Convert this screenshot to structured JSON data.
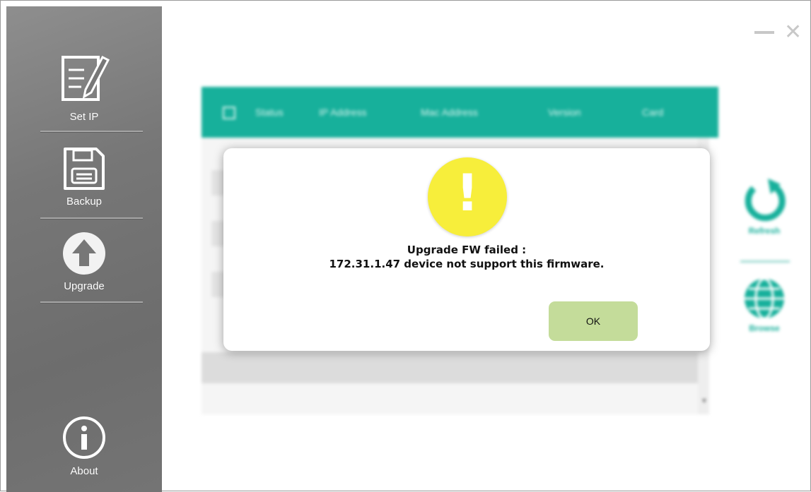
{
  "sidebar": {
    "items": [
      {
        "label": "Set IP",
        "icon": "edit-document-icon"
      },
      {
        "label": "Backup",
        "icon": "floppy-disk-icon"
      },
      {
        "label": "Upgrade",
        "icon": "upload-arrow-icon"
      }
    ],
    "about": {
      "label": "About",
      "icon": "info-icon"
    }
  },
  "window": {
    "minimize": "—",
    "close": "✕"
  },
  "table": {
    "headers": [
      "Status",
      "IP Address",
      "Mac Address",
      "Version",
      "Card"
    ]
  },
  "tools": {
    "refresh_label": "Refresh",
    "browse_label": "Browse"
  },
  "dialog": {
    "icon": "warning-icon",
    "icon_glyph": "!",
    "message_line1": "Upgrade FW failed :",
    "message_line2": "172.31.1.47 device not support this firmware.",
    "ok_label": "OK"
  },
  "colors": {
    "accent": "#17b09b",
    "warning": "#f7ee3b",
    "ok_button": "#c4dc9a",
    "sidebar": "#767676"
  }
}
